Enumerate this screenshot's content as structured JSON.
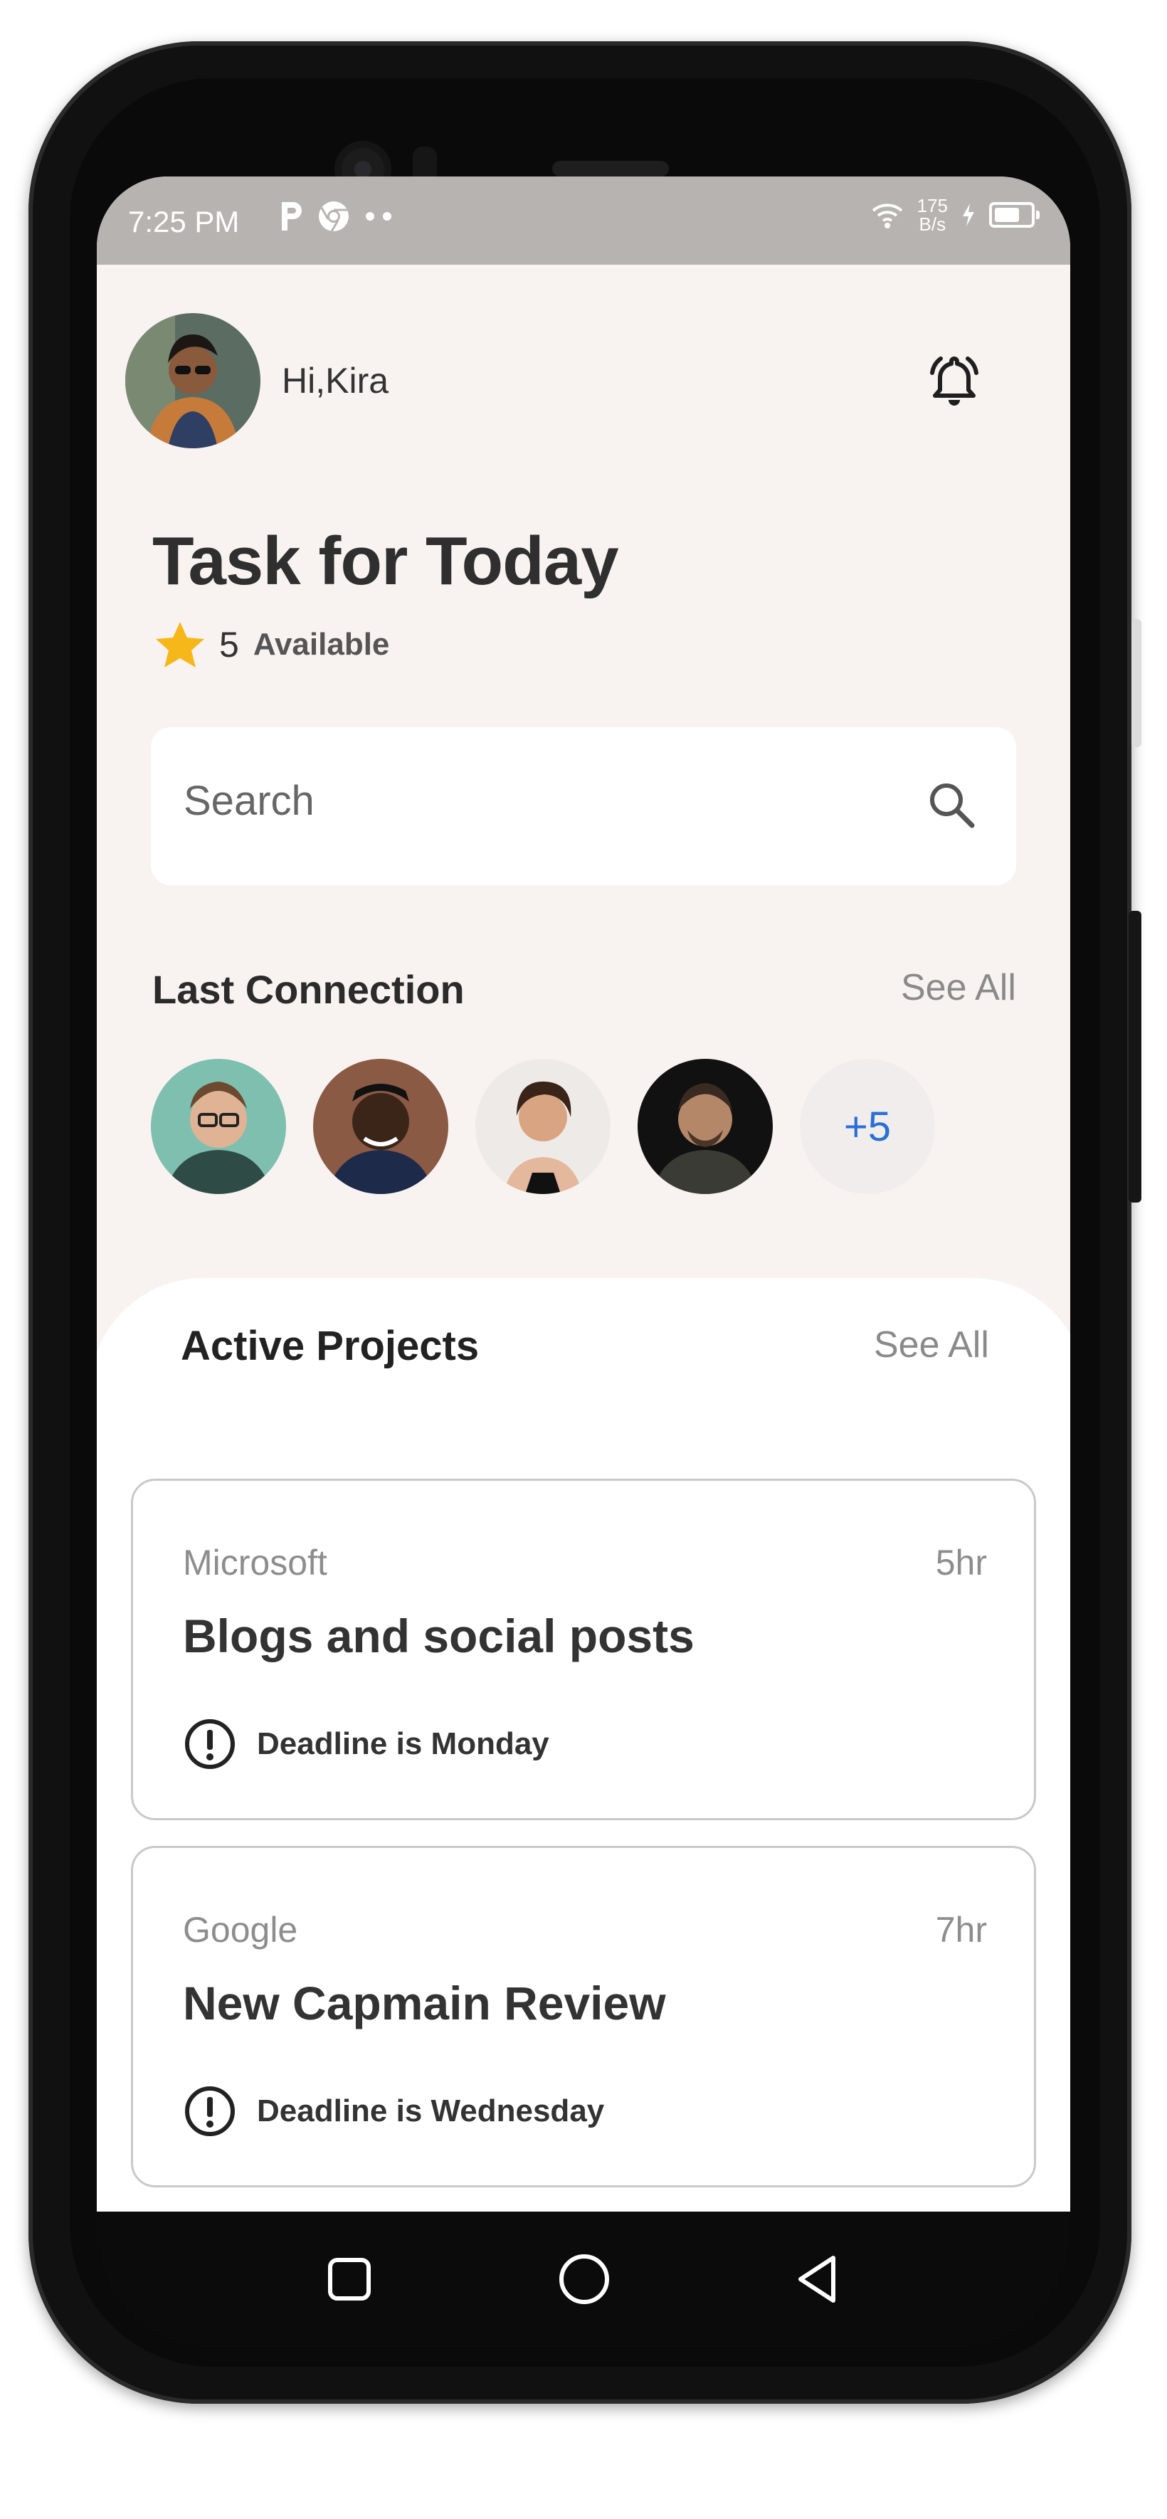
{
  "status_bar": {
    "time": "7:25 PM",
    "net_speed_value": "175",
    "net_speed_unit": "B/s"
  },
  "header": {
    "greeting": "Hi,Kira",
    "notification_icon": "bell-icon"
  },
  "tasks": {
    "title": "Task for Today",
    "available_count": "5",
    "available_label": "Available",
    "star_color": "#f6b71b"
  },
  "search": {
    "placeholder": "Search",
    "icon": "search-icon"
  },
  "last_connection": {
    "title": "Last Connection",
    "see_all": "See All",
    "more_count": "+5"
  },
  "active_projects": {
    "title": "Active Projects",
    "see_all": "See All",
    "items": [
      {
        "company": "Microsoft",
        "hours": "5hr",
        "title": "Blogs and social posts",
        "deadline": "Deadline is Monday"
      },
      {
        "company": "Google",
        "hours": "7hr",
        "title": "New Capmain Review",
        "deadline": "Deadline is Wednesday"
      }
    ]
  },
  "colors": {
    "accent": "#2a6fd6",
    "background": "#f8f3f1",
    "status_bar": "#b7b3b0"
  }
}
